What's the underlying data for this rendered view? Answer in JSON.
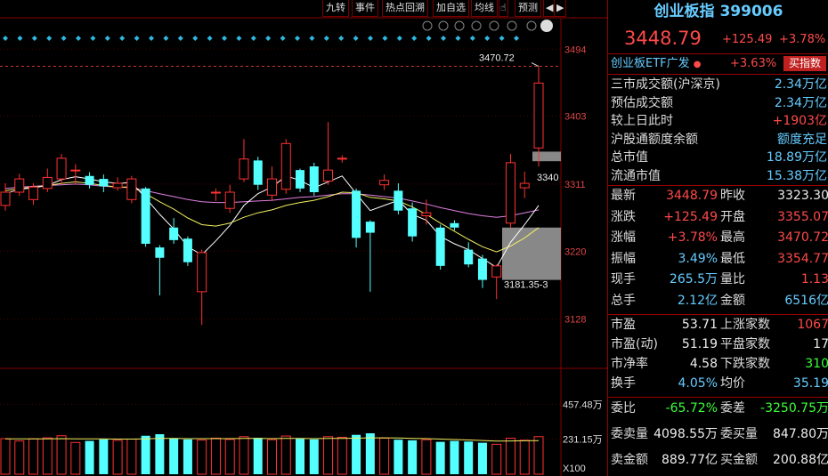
{
  "toolbar": {
    "buttons": [
      "九转",
      "事件",
      "热点回溯",
      "加自选",
      "均线",
      "预测"
    ],
    "nav_prev": "◀",
    "nav_next": "▶"
  },
  "chart_labels": {
    "price_ticks": [
      "3494",
      "3403",
      "3311",
      "3220",
      "3128"
    ],
    "volume_ticks": [
      "457.48万",
      "231.15万",
      "X100"
    ],
    "high_label": "3470.72",
    "current_tag": "3340",
    "low_label": "3181.35-3"
  },
  "chart_data": {
    "type": "candlestick",
    "ylim": [
      3090,
      3510
    ],
    "candles": [
      {
        "o": 3282,
        "c": 3300,
        "h": 3312,
        "l": 3275
      },
      {
        "o": 3300,
        "c": 3318,
        "h": 3325,
        "l": 3295
      },
      {
        "o": 3290,
        "c": 3307,
        "h": 3312,
        "l": 3283
      },
      {
        "o": 3305,
        "c": 3320,
        "h": 3332,
        "l": 3300
      },
      {
        "o": 3318,
        "c": 3346,
        "h": 3352,
        "l": 3311
      },
      {
        "o": 3330,
        "c": 3330,
        "h": 3338,
        "l": 3310
      },
      {
        "o": 3322,
        "c": 3310,
        "h": 3327,
        "l": 3305
      },
      {
        "o": 3318,
        "c": 3308,
        "h": 3324,
        "l": 3300
      },
      {
        "o": 3306,
        "c": 3312,
        "h": 3320,
        "l": 3302
      },
      {
        "o": 3290,
        "c": 3318,
        "h": 3322,
        "l": 3285
      },
      {
        "o": 3305,
        "c": 3230,
        "h": 3307,
        "l": 3226
      },
      {
        "o": 3225,
        "c": 3211,
        "h": 3228,
        "l": 3160
      },
      {
        "o": 3252,
        "c": 3235,
        "h": 3265,
        "l": 3230
      },
      {
        "o": 3237,
        "c": 3205,
        "h": 3240,
        "l": 3200
      },
      {
        "o": 3165,
        "c": 3218,
        "h": 3222,
        "l": 3120
      },
      {
        "o": 3300,
        "c": 3300,
        "h": 3305,
        "l": 3288
      },
      {
        "o": 3278,
        "c": 3300,
        "h": 3310,
        "l": 3272
      },
      {
        "o": 3318,
        "c": 3345,
        "h": 3372,
        "l": 3314
      },
      {
        "o": 3343,
        "c": 3310,
        "h": 3348,
        "l": 3303
      },
      {
        "o": 3296,
        "c": 3318,
        "h": 3335,
        "l": 3288
      },
      {
        "o": 3304,
        "c": 3366,
        "h": 3372,
        "l": 3298
      },
      {
        "o": 3330,
        "c": 3305,
        "h": 3332,
        "l": 3300
      },
      {
        "o": 3335,
        "c": 3300,
        "h": 3340,
        "l": 3295
      },
      {
        "o": 3315,
        "c": 3330,
        "h": 3395,
        "l": 3310
      },
      {
        "o": 3346,
        "c": 3346,
        "h": 3350,
        "l": 3340
      },
      {
        "o": 3302,
        "c": 3238,
        "h": 3305,
        "l": 3225
      },
      {
        "o": 3260,
        "c": 3245,
        "h": 3262,
        "l": 3165
      },
      {
        "o": 3310,
        "c": 3316,
        "h": 3324,
        "l": 3303
      },
      {
        "o": 3302,
        "c": 3275,
        "h": 3312,
        "l": 3270
      },
      {
        "o": 3278,
        "c": 3240,
        "h": 3286,
        "l": 3233
      },
      {
        "o": 3268,
        "c": 3272,
        "h": 3290,
        "l": 3256
      },
      {
        "o": 3252,
        "c": 3200,
        "h": 3256,
        "l": 3195
      },
      {
        "o": 3258,
        "c": 3252,
        "h": 3262,
        "l": 3248
      },
      {
        "o": 3222,
        "c": 3202,
        "h": 3232,
        "l": 3198
      },
      {
        "o": 3210,
        "c": 3181,
        "h": 3215,
        "l": 3170
      },
      {
        "o": 3185,
        "c": 3200,
        "h": 3202,
        "l": 3155
      },
      {
        "o": 3258,
        "c": 3340,
        "h": 3352,
        "l": 3252
      },
      {
        "o": 3306,
        "c": 3312,
        "h": 3328,
        "l": 3292
      },
      {
        "o": 3360,
        "c": 3448,
        "h": 3470,
        "l": 3335
      }
    ],
    "ma_white": [
      3298,
      3304,
      3306,
      3309,
      3317,
      3321,
      3318,
      3314,
      3312,
      3313,
      3292,
      3270,
      3250,
      3226,
      3215,
      3234,
      3255,
      3282,
      3298,
      3307,
      3322,
      3316,
      3306,
      3314,
      3322,
      3298,
      3275,
      3282,
      3289,
      3270,
      3262,
      3240,
      3230,
      3222,
      3210,
      3198,
      3232,
      3256,
      3282
    ],
    "ma_yellow": [
      3302,
      3305,
      3307,
      3309,
      3312,
      3314,
      3312,
      3309,
      3307,
      3307,
      3298,
      3287,
      3277,
      3265,
      3256,
      3254,
      3258,
      3266,
      3272,
      3276,
      3282,
      3286,
      3289,
      3294,
      3300,
      3299,
      3293,
      3291,
      3288,
      3280,
      3270,
      3258,
      3247,
      3236,
      3226,
      3219,
      3227,
      3238,
      3252
    ],
    "ma_pink": [
      3305,
      3307,
      3308,
      3309,
      3310,
      3311,
      3310,
      3308,
      3307,
      3306,
      3302,
      3298,
      3294,
      3290,
      3287,
      3286,
      3286,
      3287,
      3288,
      3289,
      3291,
      3293,
      3294,
      3296,
      3298,
      3298,
      3296,
      3294,
      3292,
      3288,
      3284,
      3279,
      3275,
      3271,
      3268,
      3266,
      3268,
      3272,
      3276
    ],
    "volume": {
      "ylim": [
        0,
        600
      ],
      "values": [
        233,
        218,
        232,
        238,
        252,
        208,
        218,
        228,
        222,
        230,
        252,
        262,
        236,
        228,
        224,
        236,
        228,
        246,
        238,
        226,
        250,
        232,
        228,
        246,
        242,
        258,
        268,
        236,
        226,
        222,
        226,
        212,
        218,
        214,
        206,
        196,
        236,
        222,
        246
      ],
      "ma": [
        232,
        231,
        231,
        232,
        233,
        232,
        231,
        231,
        230,
        230,
        232,
        234,
        234,
        233,
        233,
        233,
        233,
        234,
        234,
        233,
        234,
        234,
        233,
        234,
        234,
        236,
        238,
        238,
        237,
        235,
        233,
        230,
        227,
        224,
        221,
        217,
        218,
        219,
        220
      ]
    }
  },
  "panel": {
    "title": "创业板指 399006",
    "price": "3448.79",
    "change": "+125.49",
    "change_pct": "+3.78%",
    "etf_name": "创业板ETF广发",
    "etf_pct": "+3.63%",
    "buy_index_button": "买指数",
    "rows_a": [
      {
        "label": "三市成交额(沪深京)",
        "value": "2.34万亿",
        "cls": "cyn"
      },
      {
        "label": "预估成交额",
        "value": "2.34万亿",
        "cls": "cyn"
      },
      {
        "label": "较上日此时",
        "value": "+1903亿",
        "cls": "red"
      },
      {
        "label": "沪股通额度余额",
        "value": "额度充足",
        "cls": "cyn"
      },
      {
        "label": "总市值",
        "value": "18.89万亿",
        "cls": "cyn"
      },
      {
        "label": "流通市值",
        "value": "15.38万亿",
        "cls": "cyn"
      }
    ],
    "rows_b": [
      {
        "l1": "最新",
        "v1": "3448.79",
        "c1": "red",
        "l2": "昨收",
        "v2": "3323.30",
        "c2": "wht"
      },
      {
        "l1": "涨跌",
        "v1": "+125.49",
        "c1": "red",
        "l2": "开盘",
        "v2": "3355.07",
        "c2": "red"
      },
      {
        "l1": "涨幅",
        "v1": "+3.78%",
        "c1": "red",
        "l2": "最高",
        "v2": "3470.72",
        "c2": "red"
      },
      {
        "l1": "振幅",
        "v1": "3.49%",
        "c1": "cyn",
        "l2": "最低",
        "v2": "3354.77",
        "c2": "red"
      },
      {
        "l1": "现手",
        "v1": "265.5万",
        "c1": "cyn",
        "l2": "量比",
        "v2": "1.13",
        "c2": "red"
      },
      {
        "l1": "总手",
        "v1": "2.12亿",
        "c1": "cyn",
        "l2": "金额",
        "v2": "6516亿",
        "c2": "cyn"
      }
    ],
    "rows_c": [
      {
        "l1": "市盈",
        "v1": "53.71",
        "c1": "wht",
        "l2": "上涨家数",
        "v2": "1067",
        "c2": "red"
      },
      {
        "l1": "市盈(动)",
        "v1": "51.19",
        "c1": "wht",
        "l2": "平盘家数",
        "v2": "17",
        "c2": "wht"
      },
      {
        "l1": "市净率",
        "v1": "4.58",
        "c1": "wht",
        "l2": "下跌家数",
        "v2": "310",
        "c2": "grn"
      },
      {
        "l1": "换手",
        "v1": "4.05%",
        "c1": "cyn",
        "l2": "均价",
        "v2": "35.19",
        "c2": "cyn"
      }
    ],
    "rows_d": [
      {
        "l1": "委比",
        "v1": "-65.72%",
        "c1": "grn",
        "l2": "委差",
        "v2": "-3250.75万",
        "c2": "grn"
      },
      {
        "l1": "委卖量",
        "v1": "4098.55万",
        "c1": "wht",
        "l2": "委买量",
        "v2": "847.80万",
        "c2": "wht"
      },
      {
        "l1": "卖金额",
        "v1": "889.77亿",
        "c1": "wht",
        "l2": "买金额",
        "v2": "200.88亿",
        "c2": "wht"
      }
    ]
  },
  "colors": {
    "up": "#ff3232",
    "down": "#54ffff",
    "ma_white": "#ffffff",
    "ma_yellow": "#f0f060",
    "ma_pink": "#e080e0",
    "grid_red": "#8a0000"
  }
}
